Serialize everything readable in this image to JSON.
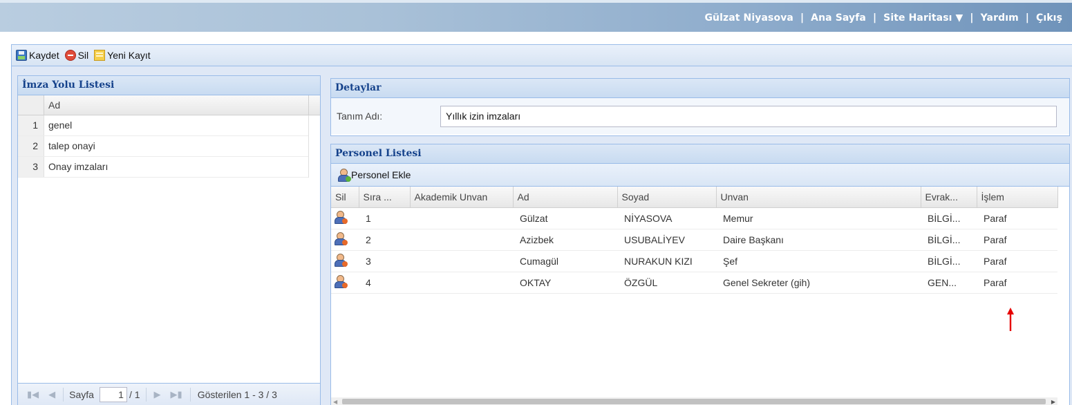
{
  "header": {
    "user_name": "Gülzat Niyasova",
    "home_link": "Ana Sayfa",
    "sitemap_link": "Site Haritası ▼",
    "help_link": "Yardım",
    "logout_link": "Çıkış",
    "separator": "|"
  },
  "toolbar": {
    "save_label": "Kaydet",
    "delete_label": "Sil",
    "new_label": "Yeni Kayıt"
  },
  "signature_list": {
    "title": "İmza Yolu Listesi",
    "column_header": "Ad",
    "rows": [
      {
        "num": "1",
        "name": "genel"
      },
      {
        "num": "2",
        "name": "talep onayi"
      },
      {
        "num": "3",
        "name": "Onay imzaları"
      }
    ],
    "pager": {
      "page_label": "Sayfa",
      "current_page": "1",
      "total_pages": "/ 1",
      "status": "Gösterilen 1 - 3 / 3"
    }
  },
  "details": {
    "title": "Detaylar",
    "definition_label": "Tanım Adı:",
    "definition_value": "Yıllık izin imzaları"
  },
  "personnel": {
    "title": "Personel Listesi",
    "add_button": "Personel Ekle",
    "columns": [
      "Sil",
      "Sıra ...",
      "Akademik Unvan",
      "Ad",
      "Soyad",
      "Unvan",
      "Evrak...",
      "İşlem"
    ],
    "rows": [
      {
        "sira": "1",
        "akademik": "",
        "ad": "Gülzat",
        "soyad": "NİYASOVA",
        "unvan": "Memur",
        "evrak": "BİLGİ...",
        "islem": "Paraf"
      },
      {
        "sira": "2",
        "akademik": "",
        "ad": "Azizbek",
        "soyad": "USUBALİYEV",
        "unvan": "Daire Başkanı",
        "evrak": "BİLGİ...",
        "islem": "Paraf"
      },
      {
        "sira": "3",
        "akademik": "",
        "ad": "Cumagül",
        "soyad": "NURAKUN KIZI",
        "unvan": "Şef",
        "evrak": "BİLGİ...",
        "islem": "Paraf"
      },
      {
        "sira": "4",
        "akademik": "",
        "ad": "OKTAY",
        "soyad": "ÖZGÜL",
        "unvan": "Genel Sekreter (gih)",
        "evrak": "GEN...",
        "islem": "Paraf"
      }
    ]
  },
  "colors": {
    "header_text": "#15428b",
    "panel_border": "#99bbe8",
    "annotation_arrow": "#e60000"
  }
}
